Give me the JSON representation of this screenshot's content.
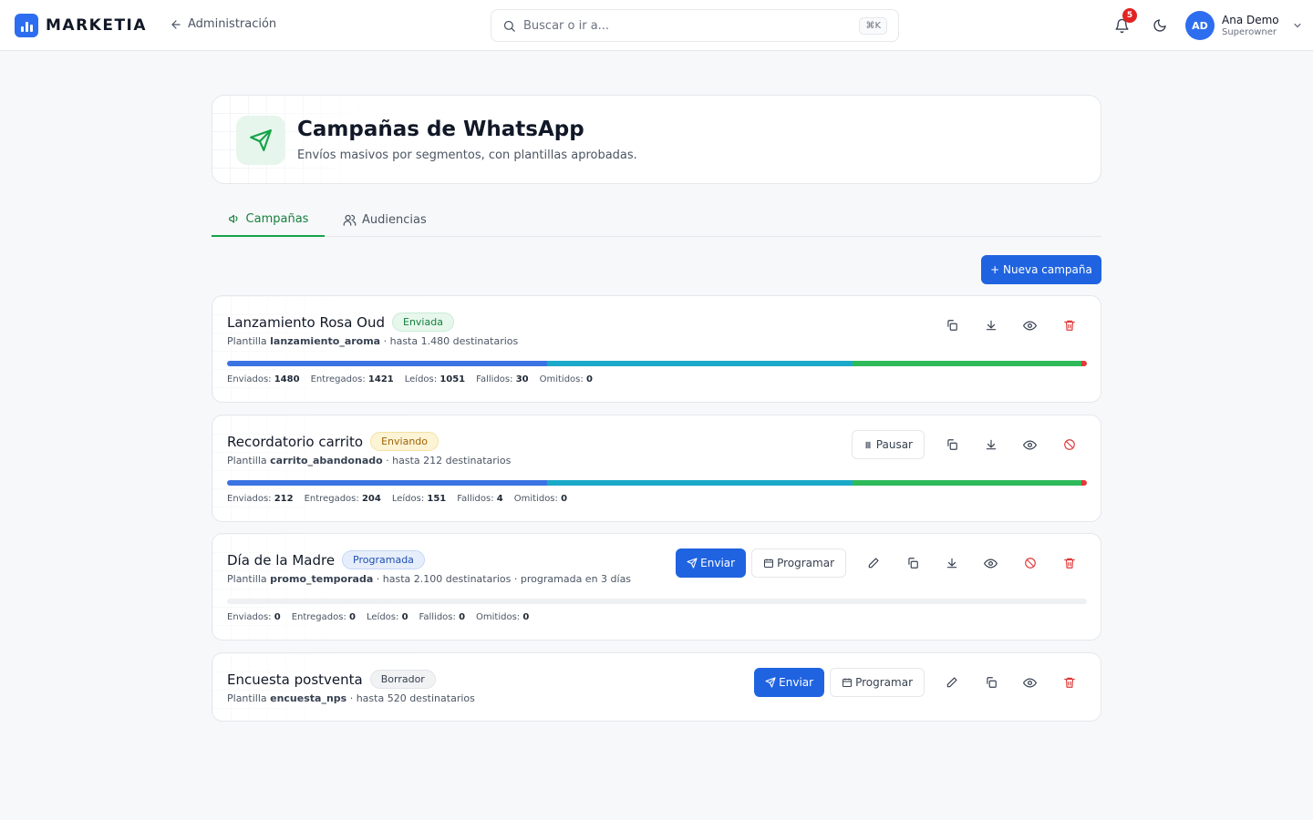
{
  "brand": {
    "name": "MARKETIA",
    "color": "#2d6ef0"
  },
  "nav": {
    "back_label": "Administración"
  },
  "search": {
    "placeholder": "Buscar o ir a...",
    "shortcut": "⌘K"
  },
  "notifications": {
    "count": "5"
  },
  "user": {
    "initials": "AD",
    "name": "Ana Demo",
    "role": "Superowner"
  },
  "page": {
    "title": "Campañas de WhatsApp",
    "subtitle": "Envíos masivos por segmentos, con plantillas aprobadas."
  },
  "tabs": [
    {
      "label": "Campañas",
      "active": true
    },
    {
      "label": "Audiencias",
      "active": false
    }
  ],
  "new_campaign_label": "+ Nueva campaña",
  "labels": {
    "template": "Plantilla",
    "pause": "Pausar",
    "send": "Enviar",
    "schedule": "Programar",
    "sent": "Enviados:",
    "delivered": "Entregados:",
    "read": "Leídos:",
    "failed": "Fallidos:",
    "skipped": "Omitidos:"
  },
  "colors": {
    "sent": "#3b74e2",
    "delivered": "#1aa9c9",
    "read": "#2fba5a",
    "failed": "#e03a3a",
    "accent_green": "#16a34a"
  },
  "campaigns": [
    {
      "name": "Lanzamiento Rosa Oud",
      "status": "Enviada",
      "template": "lanzamiento_aroma",
      "details": "· hasta 1.480 destinatarios",
      "stats": {
        "sent": "1480",
        "delivered": "1421",
        "read": "1051",
        "failed": "30",
        "skipped": "0"
      },
      "progress": {
        "sent": 0.372,
        "delivered": 0.356,
        "read": 0.266,
        "failed": 0.006
      }
    },
    {
      "name": "Recordatorio carrito",
      "status": "Enviando",
      "template": "carrito_abandonado",
      "details": "· hasta 212 destinatarios",
      "stats": {
        "sent": "212",
        "delivered": "204",
        "read": "151",
        "failed": "4",
        "skipped": "0"
      },
      "progress": {
        "sent": 0.372,
        "delivered": 0.356,
        "read": 0.266,
        "failed": 0.006
      }
    },
    {
      "name": "Día de la Madre",
      "status": "Programada",
      "template": "promo_temporada",
      "details": "· hasta 2.100 destinatarios · programada en 3 días",
      "stats": {
        "sent": "0",
        "delivered": "0",
        "read": "0",
        "failed": "0",
        "skipped": "0"
      },
      "progress": {
        "sent": 0,
        "delivered": 0,
        "read": 0,
        "failed": 0
      }
    },
    {
      "name": "Encuesta postventa",
      "status": "Borrador",
      "template": "encuesta_nps",
      "details": "· hasta 520 destinatarios"
    }
  ]
}
